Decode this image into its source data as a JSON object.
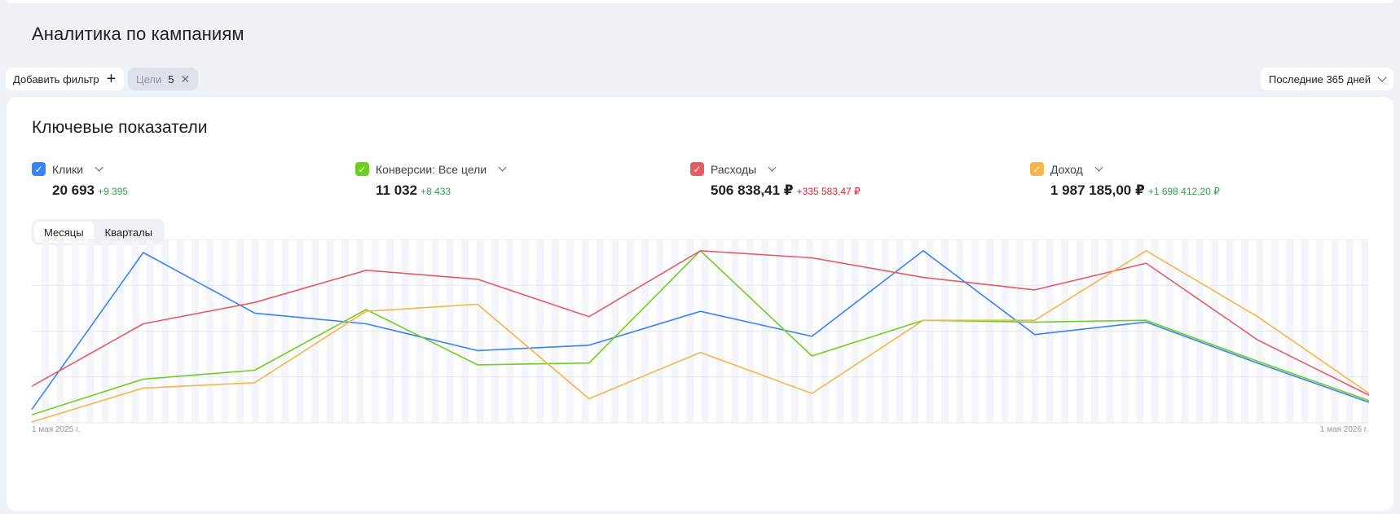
{
  "page": {
    "title": "Аналитика по кампаниям"
  },
  "filters": {
    "add_label": "Добавить фильтр",
    "chip_label": "Цели",
    "chip_count": "5",
    "period_label": "Последние 365 дней"
  },
  "card": {
    "title": "Ключевые показатели"
  },
  "metrics": [
    {
      "name": "Клики",
      "value": "20 693",
      "delta": "+9 395",
      "color": "#3a82f7",
      "delta_sign": "pos"
    },
    {
      "name": "Конверсии: Все цели",
      "value": "11 032",
      "delta": "+8 433",
      "color": "#6fcf1f",
      "delta_sign": "pos"
    },
    {
      "name": "Расходы",
      "value": "506 838,41 ₽",
      "delta": "+335 583,47 ₽",
      "color": "#e65a64",
      "delta_sign": "neg"
    },
    {
      "name": "Доход",
      "value": "1 987 185,00 ₽",
      "delta": "+1 698 412,20 ₽",
      "color": "#f8b446",
      "delta_sign": "pos"
    }
  ],
  "tabs": {
    "months": "Месяцы",
    "quarters": "Кварталы"
  },
  "chart_data": {
    "type": "line",
    "x_start_label": "1 мая 2025 г.",
    "x_end_label": "1 мая 2026 г.",
    "series": [
      {
        "name": "Клики",
        "color": "#3a82f7",
        "values": [
          0.07,
          0.95,
          0.61,
          0.55,
          0.4,
          0.43,
          0.62,
          0.48,
          0.96,
          0.49,
          0.56,
          0.33,
          0.11
        ]
      },
      {
        "name": "Конверсии: Все цели",
        "color": "#6fcf1f",
        "values": [
          0.04,
          0.24,
          0.29,
          0.63,
          0.32,
          0.33,
          0.96,
          0.37,
          0.57,
          0.56,
          0.57,
          0.34,
          0.12
        ]
      },
      {
        "name": "Расходы",
        "color": "#e65a64",
        "values": [
          0.2,
          0.55,
          0.67,
          0.85,
          0.8,
          0.59,
          0.96,
          0.92,
          0.81,
          0.74,
          0.89,
          0.46,
          0.15
        ]
      },
      {
        "name": "Доход",
        "color": "#f8b446",
        "values": [
          0.0,
          0.19,
          0.22,
          0.62,
          0.66,
          0.13,
          0.39,
          0.16,
          0.57,
          0.57,
          0.96,
          0.59,
          0.16
        ]
      }
    ],
    "ylim": [
      0,
      1
    ],
    "grid": true
  }
}
